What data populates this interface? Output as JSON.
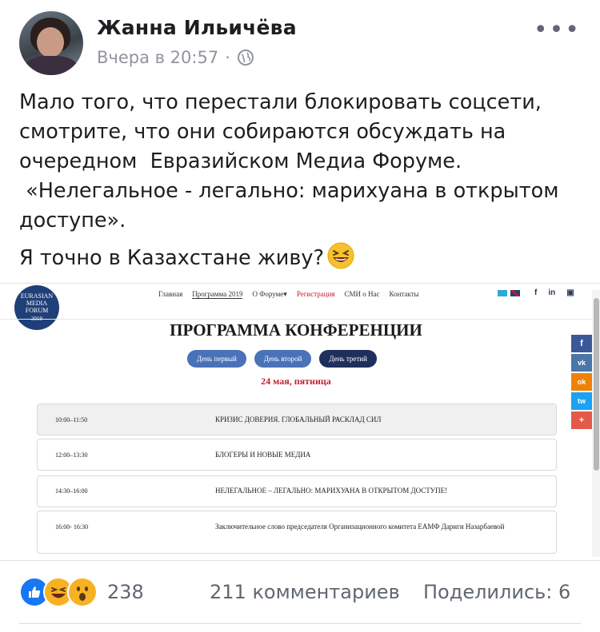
{
  "post": {
    "author": "Жанна Ильичёва",
    "time": "Вчера в 20:57",
    "separator": "·",
    "privacy_icon": "globe-icon",
    "more_icon": "•••",
    "text_main": "Мало того, что перестали блокировать соцсети,\nсмотрите, что они собираются обсуждать на\nочередном  Евразийском Медиа Форуме.\n «Нелегальное - легально: марихуана в открытом\nдоступе».",
    "text_second": "Я точно в Казахстане живу?",
    "emoji": "grinning-squinting-face"
  },
  "screenshot": {
    "logo": [
      "EURASIAN",
      "MEDIA",
      "FORUM"
    ],
    "logo_year": "2019",
    "nav": [
      "Главная",
      "Программа 2019",
      "О Форуме▾",
      "Регистрация",
      "СМИ о Нас",
      "Контакты"
    ],
    "social_top": [
      "f",
      "in",
      "▣"
    ],
    "title": "ПРОГРАММА КОНФЕРЕНЦИИ",
    "days": [
      "День первый",
      "День второй",
      "День третий"
    ],
    "date": "24 мая, пятница",
    "schedule": [
      {
        "time": "10:00–11:50",
        "title": "КРИЗИС ДОВЕРИЯ. ГЛОБАЛЬНЫЙ РАСКЛАД СИЛ"
      },
      {
        "time": "12:00–13:30",
        "title": "БЛОГЕРЫ И НОВЫЕ МЕДИА"
      },
      {
        "time": "14:30–16:00",
        "title": "НЕЛЕГАЛЬНОЕ – ЛЕГАЛЬНО: МАРИХУАНА В ОТКРЫТОМ ДОСТУПЕ!"
      },
      {
        "time": "16:00- 16:30",
        "title": "Заключительное слово председателя Организационного комитета ЕАМФ Дариги Назарбаевой"
      }
    ],
    "side_social": [
      "f",
      "vk",
      "ok",
      "tw",
      "+"
    ],
    "colors": {
      "nav_active": "#c21b2c",
      "tab": "#4a72b8",
      "tab_dark": "#1f2f5c",
      "highlight": "#2d6fd6"
    }
  },
  "footer": {
    "reaction_icons": [
      "like-icon",
      "haha-icon",
      "wow-icon"
    ],
    "reaction_count": "238",
    "comments": "211 комментариев",
    "shares": "Поделились: 6"
  }
}
